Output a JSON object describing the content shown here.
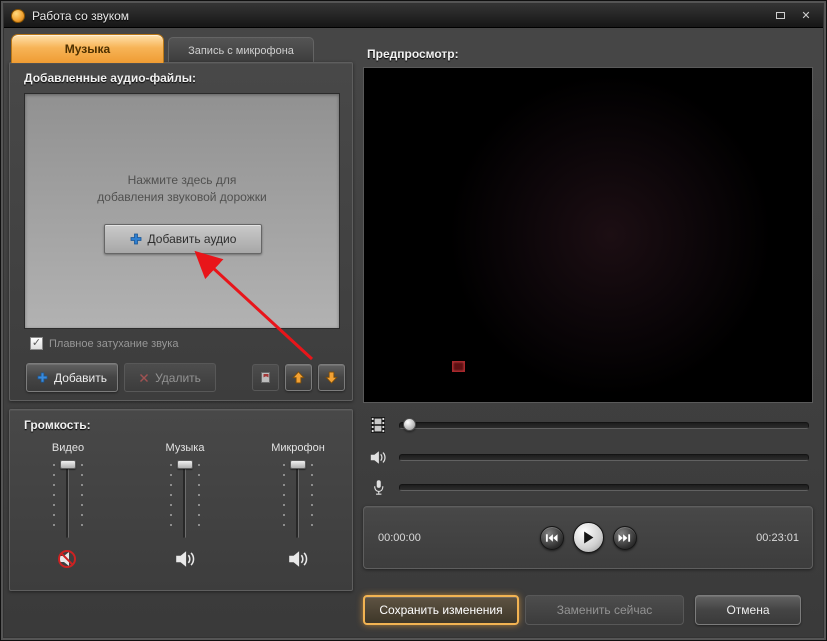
{
  "window": {
    "title": "Работа со звуком"
  },
  "icons": {
    "close": "✕",
    "check": "✓"
  },
  "colors": {
    "accent_orange": "#f2a43c",
    "arrow_red": "#e8151a",
    "plus_blue": "#2f7fd0",
    "mute_red": "#cc2222"
  },
  "tabs": {
    "music": "Музыка",
    "mic_record": "Запись с микрофона"
  },
  "audio": {
    "group_title": "Добавленные аудио-файлы:",
    "hint_line1": "Нажмите здесь для",
    "hint_line2": "добавления звуковой дорожки",
    "add_audio_label": "Добавить аудио",
    "fade_label": "Плавное затухание звука",
    "add_label": "Добавить",
    "delete_label": "Удалить"
  },
  "volume": {
    "group_title": "Громкость:",
    "sliders": [
      {
        "label": "Видео",
        "muted": true
      },
      {
        "label": "Музыка",
        "muted": false
      },
      {
        "label": "Микрофон",
        "muted": false
      }
    ]
  },
  "preview": {
    "title": "Предпросмотр:",
    "time_current": "00:00:00",
    "time_total": "00:23:01"
  },
  "footer": {
    "save_label": "Сохранить изменения",
    "replace_label": "Заменить сейчас",
    "cancel_label": "Отмена"
  }
}
